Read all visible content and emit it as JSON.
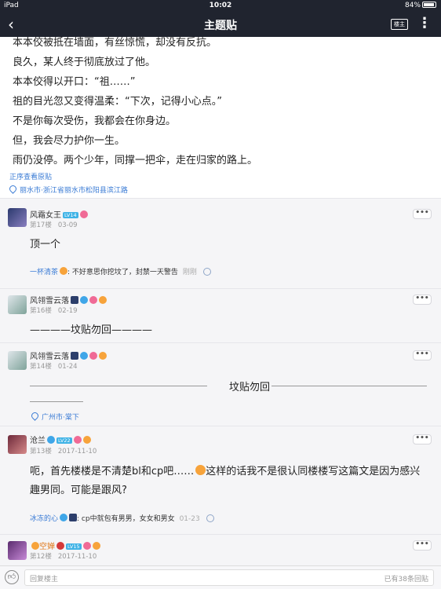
{
  "status": {
    "device": "iPad",
    "time": "10:02",
    "battery": "84%"
  },
  "nav": {
    "title": "主题贴",
    "op_label": "楼主"
  },
  "story": {
    "lines": [
      "本本佼被抵在墙面，有丝惊慌，却没有反抗。",
      "良久，某人终于彻底放过了他。",
      "本本佼得以开口：“祖……”",
      "祖的目光忽又变得温柔：“下次，记得小心点。”",
      "不是你每次受伤，我都会在你身边。",
      "但，我会尽力护你一生。",
      "雨仍没停。两个少年，同撑一把伞，走在归家的路上。"
    ],
    "view_order": "正序查看原贴",
    "location": "丽水市·浙江省丽水市松阳县滨江路"
  },
  "posts": [
    {
      "name": "风霜女王",
      "level": "LV14",
      "floor": "第17楼",
      "date": "03-09",
      "content": "顶一个",
      "reply_user": "一杯清茶",
      "reply_text": ": 不好意思你挖坟了，封禁一天警告",
      "reply_time": "刚刚"
    },
    {
      "name": "风翎雪云落",
      "floor": "第16楼",
      "date": "02-19",
      "content": "————坟贴勿回————"
    },
    {
      "name": "风翎雪云落",
      "floor": "第14楼",
      "date": "01-24",
      "content": "坟贴勿回",
      "location": "广州市·棠下"
    },
    {
      "name": "沧兰",
      "level": "LV22",
      "floor": "第13楼",
      "date": "2017-11-10",
      "content_line1": "呃，首先楼楼是不清楚bl和cp吧……",
      "content_line1b": "这样的话我不是很认同楼楼写这篇文是因为感兴",
      "content_line2": "趣男同。可能是跟风?",
      "reply_user": "冰冻的心",
      "reply_text": ": cp中就包有男男，女女和男女",
      "reply_time": "01-23"
    },
    {
      "name": "空婵",
      "level": "LV15",
      "floor": "第12楼",
      "date": "2017-11-10"
    }
  ],
  "bottom": {
    "placeholder": "回复楼主",
    "count": "已有38条回贴"
  },
  "colors": {
    "nav_bg": "#20242f",
    "link": "#3a7bd5",
    "level_badge": "#3fb3e6"
  }
}
